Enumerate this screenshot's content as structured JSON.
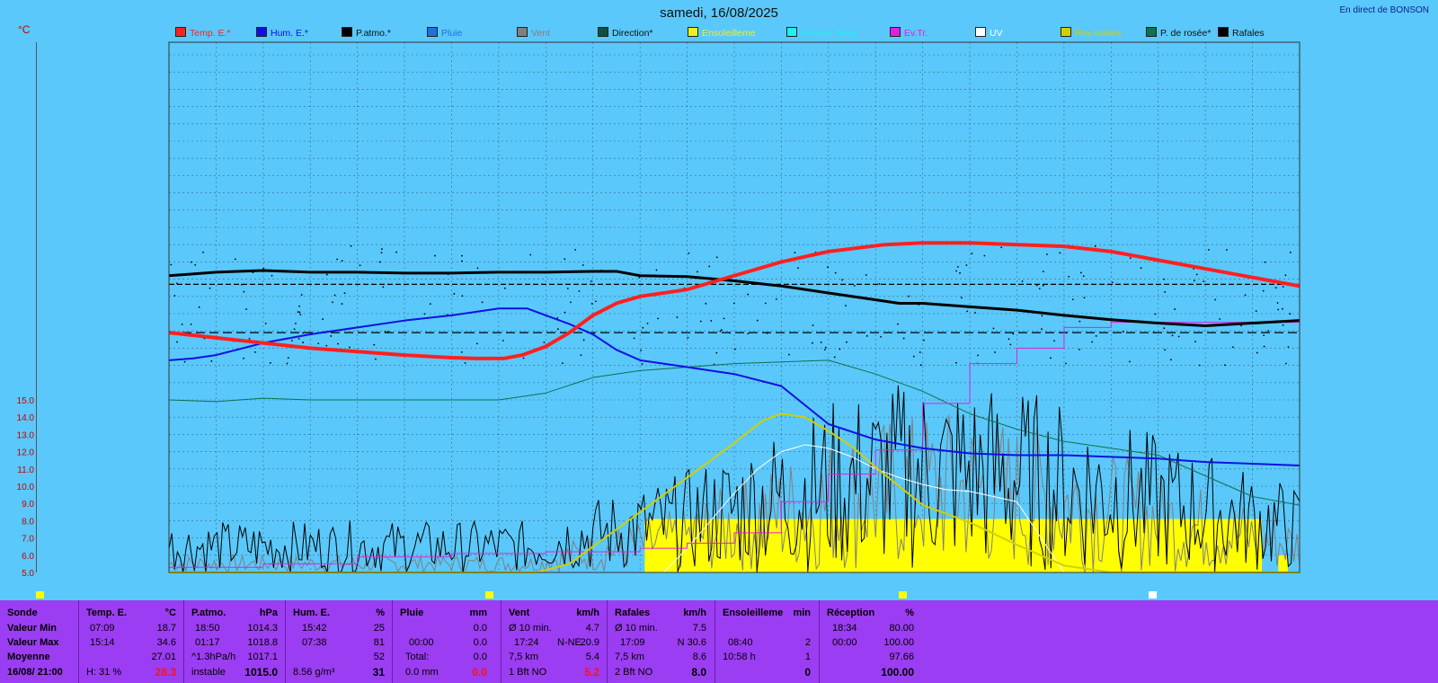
{
  "header": {
    "title": "samedi, 16/08/2025",
    "live_label": "En direct de BONSON",
    "unit": "°C"
  },
  "legend": [
    {
      "label": "Temp. E.*",
      "color": "#ff2020"
    },
    {
      "label": "Hum. E.*",
      "color": "#1010e0"
    },
    {
      "label": "P.atmo.*",
      "color": "#000000"
    },
    {
      "label": "Pluie",
      "color": "#2070e0"
    },
    {
      "label": "Vent",
      "color": "#808080"
    },
    {
      "label": "Direction*",
      "color": "#105040"
    },
    {
      "label": "Ensoleilleme",
      "color": "#f0f020"
    },
    {
      "label": "Horaire Temp",
      "color": "#20f0f0"
    },
    {
      "label": "Ev.Tr.",
      "color": "#e020e0"
    },
    {
      "label": "UV",
      "color": "#ffffff"
    },
    {
      "label": "Ray.solaire",
      "color": "#d0d000"
    },
    {
      "label": "P. de rosée*",
      "color": "#107050"
    },
    {
      "label": "Rafales",
      "color": "#000000"
    }
  ],
  "chart_data": {
    "type": "line",
    "title": "samedi, 16/08/2025",
    "ylabel": "°C",
    "ylim": [
      5.0,
      15.0
    ],
    "yticks": [
      "15.0",
      "14.0",
      "13.0",
      "12.0",
      "11.0",
      "10.0",
      "9.0",
      "8.0",
      "7.0",
      "6.0",
      "5.0"
    ],
    "x_hours": [
      0,
      24
    ],
    "series": [
      {
        "name": "Temp. E.*",
        "color": "#ff2020",
        "width": 4,
        "x": [
          0,
          1,
          2,
          3,
          4,
          5,
          6,
          6.5,
          7.1,
          7.5,
          8,
          8.5,
          9,
          9.5,
          10,
          11,
          12,
          13,
          14,
          15.2,
          16,
          17,
          18,
          19,
          20,
          21,
          22,
          23,
          24
        ],
        "y": [
          18.9,
          18.6,
          18.3,
          18.0,
          17.8,
          17.6,
          17.45,
          17.4,
          17.4,
          17.6,
          18.1,
          18.9,
          19.9,
          20.6,
          21.0,
          21.4,
          22.2,
          23.0,
          23.6,
          24.0,
          24.1,
          24.1,
          24.0,
          23.9,
          23.6,
          23.1,
          22.6,
          22.1,
          21.6
        ]
      },
      {
        "name": "Hum. E.*",
        "color": "#1010e0",
        "width": 2,
        "x": [
          0,
          0.5,
          1,
          2,
          3,
          4,
          5,
          6,
          7,
          7.6,
          8.5,
          9,
          9.5,
          10,
          11,
          12,
          13,
          13.5,
          14,
          15,
          16,
          17,
          18,
          19,
          20,
          21,
          21.5,
          22,
          23,
          24
        ],
        "y": [
          17.3,
          17.4,
          17.6,
          18.3,
          18.8,
          19.2,
          19.6,
          19.9,
          20.3,
          20.3,
          19.4,
          18.8,
          17.9,
          17.3,
          16.9,
          16.5,
          15.8,
          14.7,
          13.6,
          12.7,
          12.2,
          11.9,
          11.8,
          11.8,
          11.7,
          11.6,
          11.5,
          11.4,
          11.3,
          11.2
        ]
      },
      {
        "name": "P.atmo.*",
        "color": "#000000",
        "width": 3,
        "x": [
          0,
          0.5,
          1,
          2,
          3,
          4,
          5,
          6,
          7,
          8,
          9,
          9.5,
          10,
          11,
          12,
          13,
          14,
          15,
          15.5,
          16,
          17,
          18,
          19,
          20,
          21,
          22,
          23,
          24
        ],
        "y": [
          22.2,
          22.3,
          22.4,
          22.5,
          22.4,
          22.4,
          22.35,
          22.35,
          22.4,
          22.4,
          22.45,
          22.45,
          22.2,
          22.15,
          21.9,
          21.6,
          21.2,
          20.8,
          20.6,
          20.6,
          20.4,
          20.2,
          19.9,
          19.65,
          19.45,
          19.3,
          19.45,
          19.6
        ]
      },
      {
        "name": "P. de rosée*",
        "color": "#107050",
        "width": 1,
        "x": [
          0,
          1,
          2,
          3,
          4,
          5,
          6,
          7,
          8,
          9,
          10,
          11,
          12,
          13,
          14,
          15,
          16,
          17,
          18,
          19,
          20,
          21,
          22,
          23,
          24
        ],
        "y": [
          15.0,
          14.9,
          15.1,
          15.0,
          15.0,
          15.0,
          15.0,
          15.0,
          15.4,
          16.3,
          16.7,
          16.9,
          17.1,
          17.2,
          17.3,
          16.5,
          15.5,
          14.2,
          13.3,
          12.6,
          12.2,
          11.8,
          10.6,
          9.4,
          8.9
        ]
      },
      {
        "name": "Ray.solaire",
        "color": "#d0d000",
        "width": 2,
        "x": [
          0,
          7.8,
          8.5,
          9,
          9.5,
          10,
          11,
          12,
          12.6,
          13,
          13.5,
          14,
          14.5,
          15,
          15.5,
          16,
          17,
          18,
          19,
          20,
          21,
          22,
          23,
          23.5,
          24
        ],
        "y": [
          5.0,
          5.0,
          5.5,
          6.5,
          7.5,
          8.5,
          10.5,
          12.5,
          13.8,
          14.2,
          14.0,
          13.2,
          12.3,
          11.1,
          10.0,
          8.9,
          7.9,
          6.6,
          5.4,
          5.0,
          5.0,
          5.0,
          5.0,
          5.0,
          5.0
        ]
      },
      {
        "name": "UV",
        "color": "#ffffff",
        "width": 1,
        "x": [
          0,
          10.5,
          11,
          11.5,
          12,
          12.5,
          13,
          13.5,
          14,
          14.5,
          15,
          15.5,
          16,
          16.5,
          17,
          17.5,
          18,
          19,
          24
        ],
        "y": [
          5.0,
          5.0,
          6.4,
          8.0,
          9.6,
          11.0,
          12.0,
          12.4,
          12.2,
          11.7,
          11.0,
          10.5,
          10.1,
          9.8,
          9.7,
          9.4,
          9.1,
          5.0,
          5.0
        ]
      },
      {
        "name": "Ev.Tr.",
        "color": "#e020e0",
        "width": 1,
        "step": true,
        "x": [
          0,
          2,
          4,
          6,
          8,
          10,
          11,
          12,
          13,
          14,
          15,
          16,
          17,
          18,
          19,
          20,
          24
        ],
        "y": [
          5.3,
          5.5,
          5.9,
          6.1,
          6.2,
          6.4,
          6.7,
          7.3,
          9.1,
          10.7,
          12.1,
          14.8,
          17.1,
          18.0,
          19.2,
          19.5,
          19.5
        ]
      }
    ],
    "reference_lines": [
      {
        "y": 18.9,
        "dash": "10,5",
        "color": "#000000"
      },
      {
        "y": 21.7,
        "dash": "6,3",
        "color": "#000000"
      }
    ]
  },
  "footer": {
    "marker_colors": [
      "#ffff00",
      "#ffff00",
      "#ffff00",
      "#ffffff"
    ],
    "sonde": {
      "header": "Sonde",
      "min": "Valeur Min",
      "max": "Valeur Max",
      "avg": "Moyenne",
      "now": "16/08/ 21:00"
    },
    "temp": {
      "label": "Temp. E.",
      "unit": "°C",
      "min_time": "07:09",
      "min": "18.7",
      "max_time": "15:14",
      "max": "34.6",
      "avg": "27.01",
      "humidity": "H: 31 %",
      "current": "28.3"
    },
    "patmo": {
      "label": "P.atmo.",
      "unit": "hPa",
      "min_time": "18:50",
      "min": "1014.3",
      "max_time": "01:17",
      "max": "1018.8",
      "trend": "^1.3hPa/h",
      "avg": "1017.1",
      "state": "instable",
      "current": "1015.0"
    },
    "hum": {
      "label": "Hum. E.",
      "unit": "%",
      "min_time": "15:42",
      "min": "25",
      "max_time": "07:38",
      "max": "81",
      "avg": "52",
      "abs": "8.56 g/m³",
      "current": "31"
    },
    "pluie": {
      "label": "Pluie",
      "unit": "mm",
      "t1": "00:00",
      "v1": "0.0",
      "v0": "0.0",
      "total_label": "Total:",
      "total": "0.0",
      "rate": "0.0 mm",
      "current": "0.0"
    },
    "vent": {
      "label": "Vent",
      "unit": "km/h",
      "avg_label": "Ø 10 min.",
      "avg": "4.7",
      "time": "17:24",
      "dir": "N-NE",
      "max": "20.9",
      "dist": "7,5 km",
      "dist_v": "5.4",
      "bft": "1 Bft NO",
      "current": "5.2"
    },
    "rafales": {
      "label": "Rafales",
      "unit": "km/h",
      "avg_label": "Ø 10 min.",
      "avg": "7.5",
      "time": "17:09",
      "max": "N 30.6",
      "dist": "7,5 km",
      "dist_v": "8.6",
      "bft": "2 Bft NO",
      "current": "8.0"
    },
    "soleil": {
      "label": "Ensoleilleme",
      "unit": "min",
      "t1": "08:40",
      "v1": "2",
      "t2": "10:58 h",
      "v2": "1",
      "current": "0"
    },
    "reception": {
      "label": "Réception",
      "unit": "%",
      "t1": "18:34",
      "v1": "80.00",
      "t2": "00:00",
      "v2": "100.00",
      "avg": "97.66",
      "current": "100.00"
    }
  }
}
